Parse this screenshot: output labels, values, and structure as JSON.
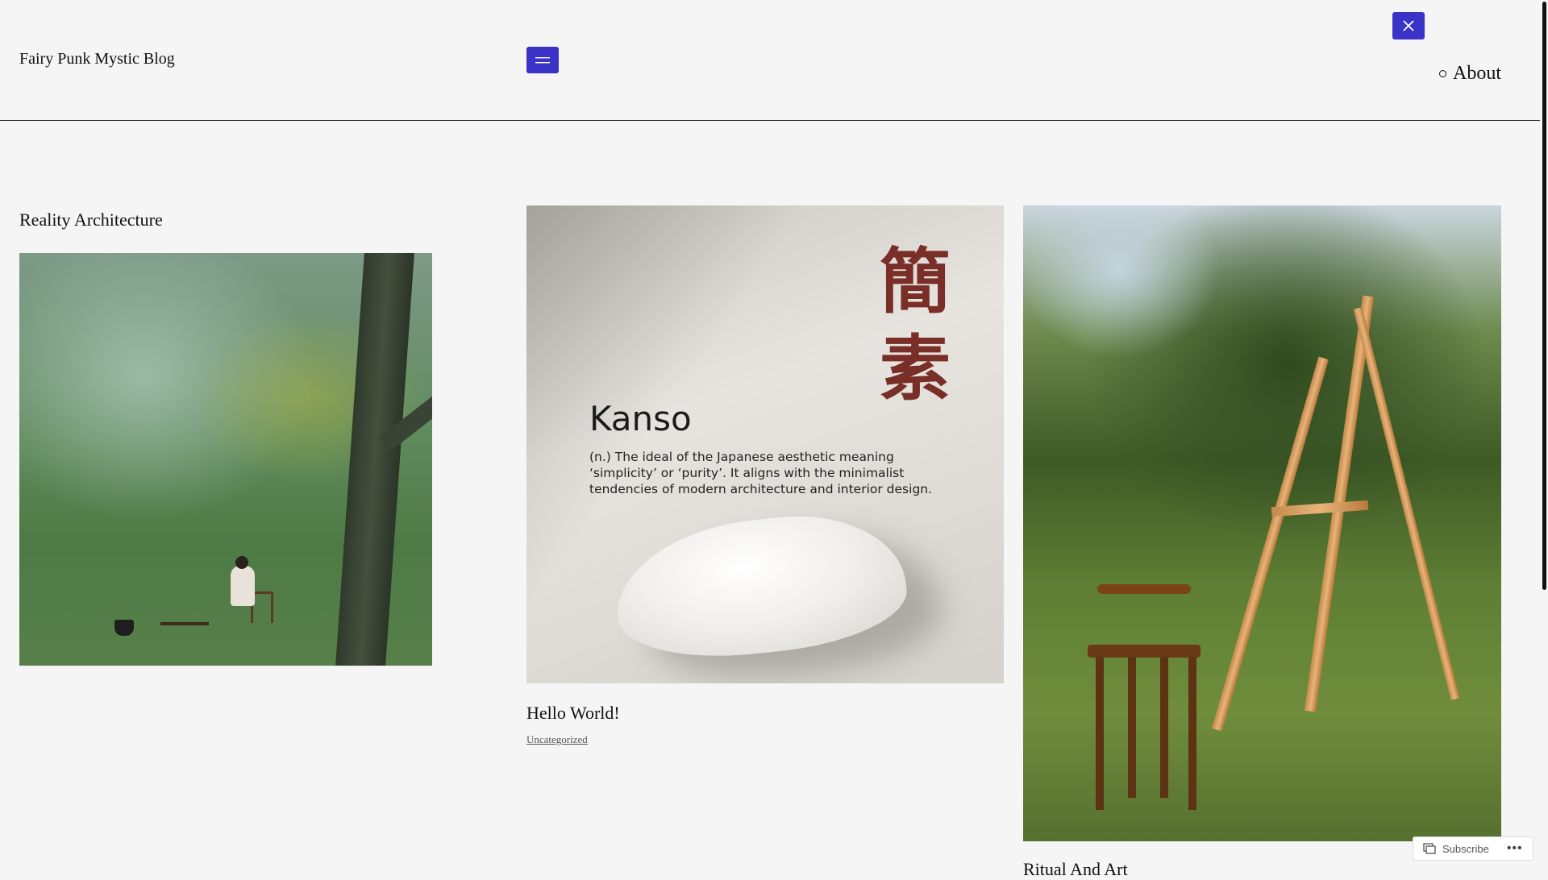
{
  "header": {
    "site_title": "Fairy Punk Mystic Blog",
    "nav_items": [
      {
        "label": "About"
      }
    ],
    "menu_open_icon": "hamburger-icon",
    "menu_close_icon": "close-icon",
    "accent_color": "#3b33c8"
  },
  "posts": [
    {
      "title": "Reality Architecture",
      "category": ""
    },
    {
      "title": "Hello World!",
      "category": "Uncategorized",
      "image_text": {
        "kanji_1": "簡",
        "kanji_2": "素",
        "word": "Kanso",
        "definition": "(n.) The ideal of the Japanese aesthetic meaning ‘simplicity’ or ‘purity’. It aligns with the minimalist tendencies of modern architecture and interior design."
      }
    },
    {
      "title": "Ritual And Art",
      "category": ""
    }
  ],
  "subscribe": {
    "label": "Subscribe",
    "icon": "subscribe-icon",
    "more": "•••"
  }
}
